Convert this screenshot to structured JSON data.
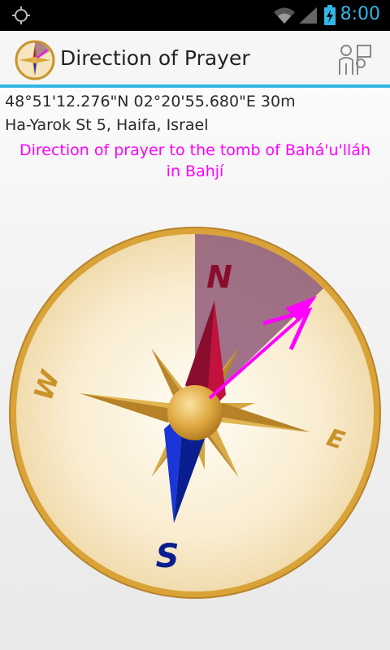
{
  "status_bar": {
    "time": "8:00",
    "icons": [
      "gps-icon",
      "wifi-icon",
      "signal-icon",
      "battery-charging-icon"
    ],
    "accent_color": "#33b5e5"
  },
  "action_bar": {
    "title": "Direction of Prayer",
    "app_icon": "compass-star-icon",
    "action_icon": "people-flag-icon"
  },
  "location": {
    "coordinates": "48°51'12.276\"N 02°20'55.680\"E 30m",
    "address": "Ha-Yarok St 5, Haifa, Israel"
  },
  "prayer": {
    "caption": "Direction of prayer to the tomb of Bahá'u'lláh in Bahjí",
    "color": "#ff00ff",
    "bearing_degrees": 50
  },
  "compass": {
    "north": "N",
    "east": "E",
    "south": "S",
    "west": "W",
    "north_color": "#8b0d2e",
    "south_color": "#0a1f8f",
    "sector_color": "#8f5b79"
  }
}
